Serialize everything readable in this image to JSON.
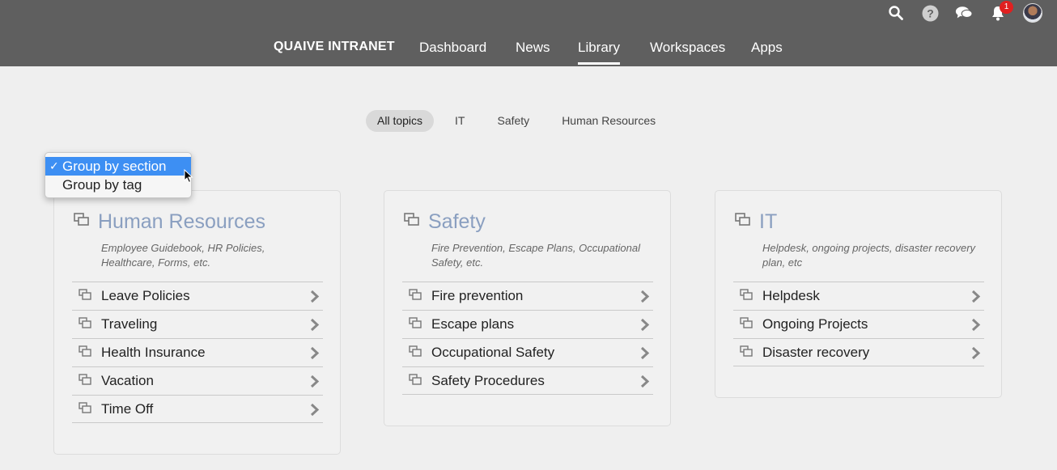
{
  "header": {
    "brand": "QUAIVE INTRANET",
    "nav": [
      {
        "label": "Dashboard"
      },
      {
        "label": "News"
      },
      {
        "label": "Library"
      },
      {
        "label": "Workspaces"
      },
      {
        "label": "Apps"
      }
    ],
    "active_nav": "Library",
    "notification_count": "1",
    "icons": [
      "search-icon",
      "help-icon",
      "chat-icon",
      "notifications-icon",
      "avatar"
    ]
  },
  "filters": {
    "pills": [
      "All topics",
      "IT",
      "Safety",
      "Human Resources"
    ],
    "active": "All topics"
  },
  "group_dropdown": {
    "check": "✓",
    "options": [
      "Group by section",
      "Group by tag"
    ],
    "selected": "Group by section"
  },
  "sections": [
    {
      "title": "Human Resources",
      "description": [
        "Employee Guidebook, HR Policies,",
        "Healthcare, Forms, etc."
      ],
      "items": [
        "Leave Policies",
        "Traveling",
        "Health Insurance",
        "Vacation",
        "Time Off"
      ]
    },
    {
      "title": "Safety",
      "description": [
        "Fire Prevention, Escape Plans, Occupational",
        "Safety, etc."
      ],
      "items": [
        "Fire prevention",
        "Escape plans",
        "Occupational Safety",
        "Safety Procedures"
      ]
    },
    {
      "title": "IT",
      "description": [
        "Helpdesk, ongoing projects, disaster recovery",
        "plan, etc"
      ],
      "items": [
        "Helpdesk",
        "Ongoing Projects",
        "Disaster recovery"
      ]
    }
  ],
  "colors": {
    "topbar": "#5f5f5f",
    "accent_title": "#8a9fc0",
    "selection": "#3d8ff3",
    "badge": "#e02020"
  }
}
